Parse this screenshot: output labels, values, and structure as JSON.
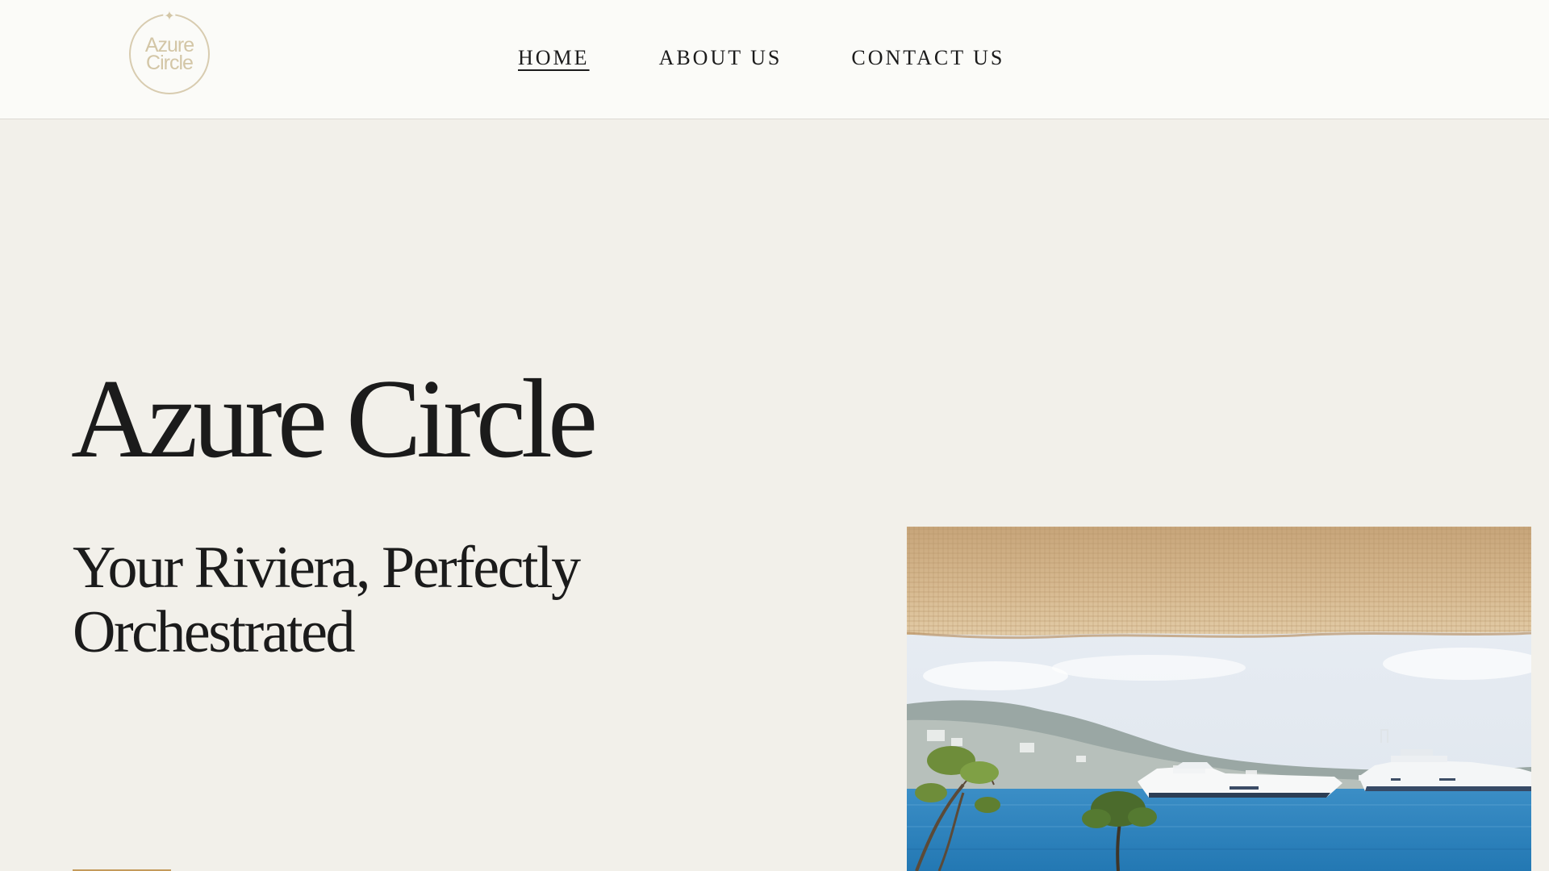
{
  "header": {
    "logo": {
      "line1": "Azure",
      "line2": "Circle",
      "text": "Azure\nCircle",
      "star": "✦",
      "color": "#d3c6a6"
    },
    "nav": [
      {
        "label": "HOME",
        "active": true
      },
      {
        "label": "ABOUT US",
        "active": false
      },
      {
        "label": "CONTACT US",
        "active": false
      }
    ]
  },
  "hero": {
    "title": "Azure Circle",
    "subtitle": "Your Riviera, Perfectly Orchestrated",
    "cta_accent_color": "#c49a5a",
    "photo": {
      "subject": "straw-awning-sea-yachts-photo"
    }
  },
  "colors": {
    "page_background": "#f2f0ea",
    "header_background": "#fbfbf8",
    "text": "#1b1b1b",
    "sea": "#2f86c0"
  }
}
